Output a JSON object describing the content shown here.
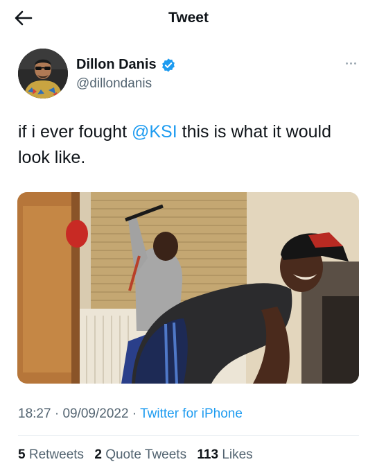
{
  "header": {
    "title": "Tweet",
    "back_icon": "arrow-left-icon"
  },
  "author": {
    "display_name": "Dillon Danis",
    "handle": "@dillondanis",
    "verified_icon": "verified-badge-icon",
    "verified_color": "#1d9bf0"
  },
  "tweet": {
    "text_before": "if i ever fought ",
    "mention": "@KSI",
    "text_after": " this is what it would look like."
  },
  "meta": {
    "time": "18:27",
    "date": "09/09/2022",
    "source": "Twitter for iPhone"
  },
  "stats": {
    "retweets_count": "5",
    "retweets_label": "Retweets",
    "quotes_count": "2",
    "quotes_label": "Quote Tweets",
    "likes_count": "113",
    "likes_label": "Likes"
  },
  "colors": {
    "accent": "#1d9bf0",
    "secondary_text": "#536471",
    "divider": "#e6ecf0"
  }
}
